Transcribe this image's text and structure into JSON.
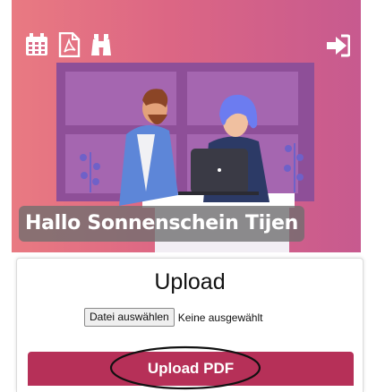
{
  "header": {
    "icons": [
      "calendar-icon",
      "pdf-file-icon",
      "binoculars-icon",
      "logout-icon"
    ],
    "greeting": "Hallo Sonnenschein Tijen",
    "colors": {
      "gradient_start": "#e97a82",
      "gradient_end": "#c75a8f"
    }
  },
  "upload": {
    "title": "Upload",
    "file_button_label": "Datei auswählen",
    "file_status": "Keine ausgewählt",
    "submit_label": "Upload PDF",
    "accent_color": "#b63058"
  }
}
